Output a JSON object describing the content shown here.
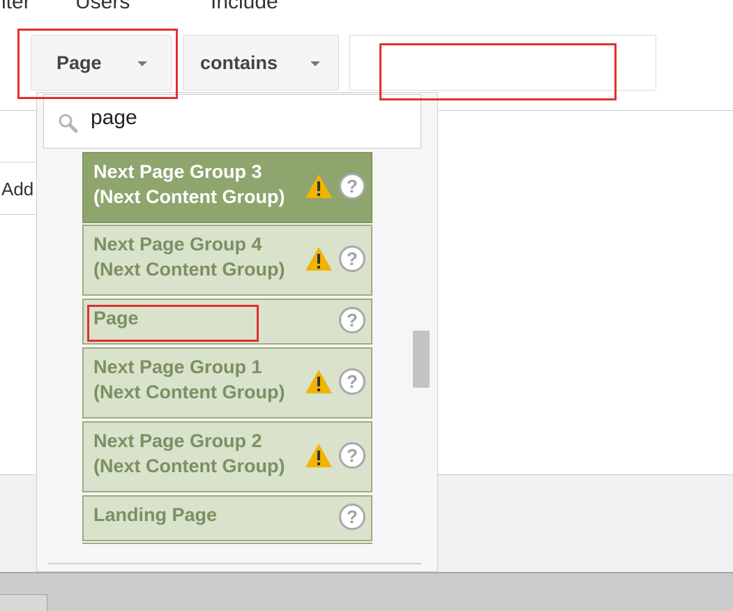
{
  "header": {
    "labels": [
      "nter",
      "Users",
      "Include"
    ]
  },
  "filter": {
    "dimension_label": "Page",
    "operator_label": "contains",
    "value": ""
  },
  "background": {
    "add_button_label": "Add"
  },
  "dropdown": {
    "search_value": "page",
    "items": [
      {
        "line1": "Next Page Group 3",
        "line2": "(Next Content Group)",
        "warning": true,
        "selected": true
      },
      {
        "line1": "Next Page Group 4",
        "line2": "(Next Content Group)",
        "warning": true,
        "selected": false
      },
      {
        "line1": "Page",
        "line2": "",
        "warning": false,
        "selected": false
      },
      {
        "line1": "Next Page Group 1",
        "line2": "(Next Content Group)",
        "warning": true,
        "selected": false
      },
      {
        "line1": "Next Page Group 2",
        "line2": "(Next Content Group)",
        "warning": true,
        "selected": false
      },
      {
        "line1": "Landing Page",
        "line2": "",
        "warning": false,
        "selected": false
      }
    ],
    "help_glyph": "?",
    "warning_glyph": "!"
  },
  "icons": {
    "search": "search-icon",
    "warning": "warning-icon",
    "help": "help-icon",
    "caret": "chevron-down-icon"
  },
  "colors": {
    "item_bg": "#d9e2cb",
    "item_selected_bg": "#8fa56e",
    "highlight": "#e03030",
    "warning": "#f2b400"
  }
}
